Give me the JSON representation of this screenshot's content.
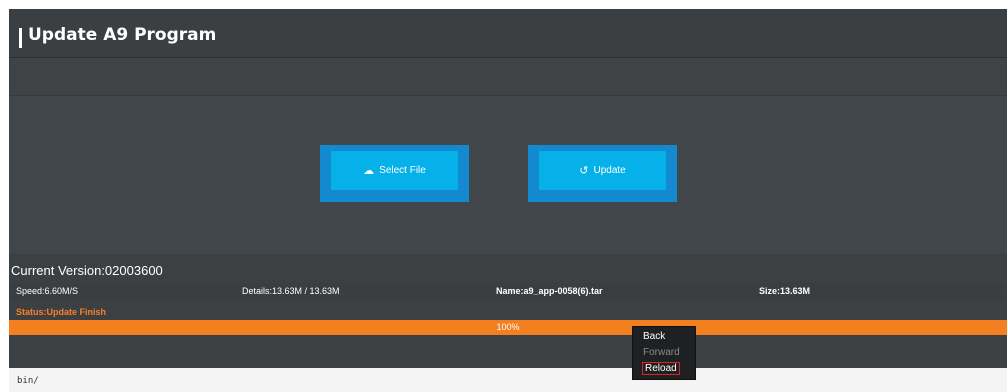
{
  "header": {
    "title": "Update A9 Program"
  },
  "buttons": {
    "select_file_label": "Select File",
    "select_file_icon": "cloud-upload-icon",
    "update_label": "Update",
    "update_icon": "refresh-icon"
  },
  "version": {
    "text": "Current Version:02003600"
  },
  "stats": {
    "speed": "Speed:6.60M/S",
    "details": "Details:13.63M / 13.63M",
    "name": "Name:a9_app-0058(6).tar",
    "size": "Size:13.63M"
  },
  "status": {
    "text": "Status:Update Finish",
    "color": "#f5812a"
  },
  "progress": {
    "percent_label": "100%",
    "value": 1.0,
    "color": "#f47f20"
  },
  "log": {
    "lines": [
      "bin/"
    ]
  },
  "context_menu": {
    "items": [
      {
        "label": "Back",
        "enabled": true
      },
      {
        "label": "Forward",
        "enabled": false
      },
      {
        "label": "Reload",
        "enabled": true,
        "highlighted": true
      }
    ]
  },
  "colors": {
    "button_outer": "#1389cf",
    "button_inner": "#06b0e8",
    "panel": "#3c4043"
  }
}
